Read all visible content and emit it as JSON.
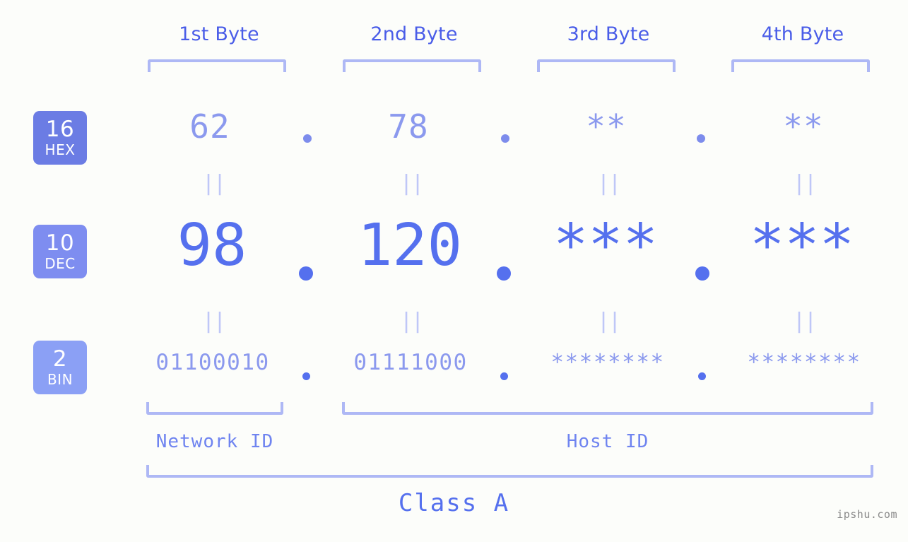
{
  "meta": {
    "background_color": "#fcfdfa",
    "accent_color": "#5570ee",
    "bracket_color": "#aeb8f5",
    "watermark": "ipshu.com"
  },
  "byte_headers": [
    {
      "label": "1st Byte"
    },
    {
      "label": "2nd Byte"
    },
    {
      "label": "3rd Byte"
    },
    {
      "label": "4th Byte"
    }
  ],
  "bases": [
    {
      "number": "16",
      "name": "HEX",
      "color": "#6b7ce4"
    },
    {
      "number": "10",
      "name": "DEC",
      "color": "#7e8df0"
    },
    {
      "number": "2",
      "name": "BIN",
      "color": "#8ba0f5"
    }
  ],
  "rows": {
    "hex": {
      "base_number": "16",
      "base_name": "HEX",
      "values": [
        "62",
        "78",
        "**",
        "**"
      ],
      "separator": "."
    },
    "dec": {
      "base_number": "10",
      "base_name": "DEC",
      "values": [
        "98",
        "120",
        "***",
        "***"
      ],
      "separator": "."
    },
    "bin": {
      "base_number": "2",
      "base_name": "BIN",
      "values": [
        "01100010",
        "01111000",
        "********",
        "********"
      ],
      "separator": "."
    }
  },
  "equivalence_marks": {
    "symbol": "||",
    "count_per_row": 4
  },
  "segments": {
    "network_id": {
      "label": "Network ID"
    },
    "host_id": {
      "label": "Host ID"
    }
  },
  "class": {
    "label": "Class A"
  }
}
